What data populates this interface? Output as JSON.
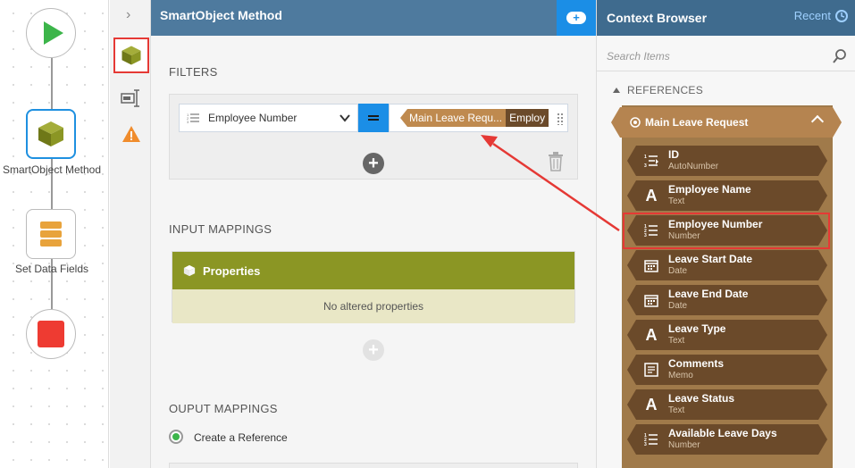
{
  "workflow": {
    "nodes": [
      {
        "label": "",
        "type": "start"
      },
      {
        "label": "SmartObject Method",
        "type": "smartobject"
      },
      {
        "label": "Set Data Fields",
        "type": "data-fields"
      },
      {
        "label": "",
        "type": "end"
      }
    ]
  },
  "colors": {
    "accent": "#1b8ee6",
    "header": "#4e7a9e",
    "context_header": "#3f6b8e",
    "smartobject_olive": "#8b9624",
    "reference_brown": "#b58450",
    "field_dark_brown": "#6b4a2a",
    "highlight_red": "#e53935",
    "start_green": "#3cb54a",
    "stop_red": "#ee3b32"
  },
  "panel": {
    "title": "SmartObject Method",
    "filters_title": "FILTERS",
    "filter": {
      "field": "Employee Number",
      "operator": "=",
      "value_reference": "Main Leave Requ...",
      "value_field": "Employ"
    },
    "input_title": "INPUT MAPPINGS",
    "properties_label": "Properties",
    "no_props": "No altered properties",
    "output_title": "OUPUT MAPPINGS",
    "create_reference": "Create a Reference"
  },
  "context": {
    "title": "Context Browser",
    "recent_label": "Recent",
    "search_placeholder": "Search Items",
    "references_label": "REFERENCES",
    "reference_name": "Main Leave Request",
    "fields": [
      {
        "name": "ID",
        "type": "AutoNumber",
        "icon": "autonumber-icon"
      },
      {
        "name": "Employee Name",
        "type": "Text",
        "icon": "text-icon"
      },
      {
        "name": "Employee Number",
        "type": "Number",
        "icon": "number-icon"
      },
      {
        "name": "Leave Start Date",
        "type": "Date",
        "icon": "date-icon"
      },
      {
        "name": "Leave End Date",
        "type": "Date",
        "icon": "date-icon"
      },
      {
        "name": "Leave Type",
        "type": "Text",
        "icon": "text-icon"
      },
      {
        "name": "Comments",
        "type": "Memo",
        "icon": "memo-icon"
      },
      {
        "name": "Leave Status",
        "type": "Text",
        "icon": "text-icon"
      },
      {
        "name": "Available Leave Days",
        "type": "Number",
        "icon": "number-icon"
      }
    ]
  }
}
